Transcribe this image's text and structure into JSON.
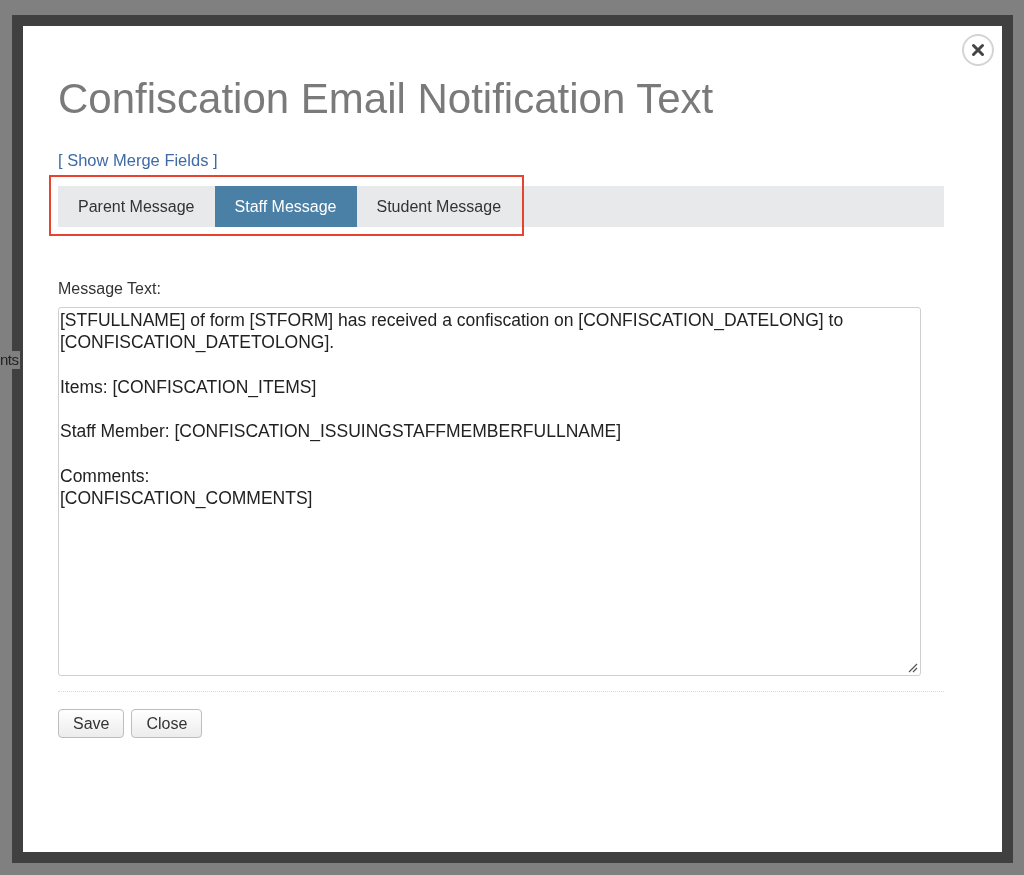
{
  "background": {
    "text": "nts"
  },
  "dialog": {
    "title": "Confiscation Email Notification Text",
    "merge_fields_link": "[ Show Merge Fields ]",
    "tabs": [
      {
        "label": "Parent Message",
        "selected": false
      },
      {
        "label": "Staff Message",
        "selected": true
      },
      {
        "label": "Student Message",
        "selected": false
      }
    ],
    "message_text": {
      "label": "Message Text:",
      "value": "[STFULLNAME] of form [STFORM] has received a confiscation on [CONFISCATION_DATELONG] to [CONFISCATION_DATETOLONG].\n\nItems: [CONFISCATION_ITEMS]\n\nStaff Member: [CONFISCATION_ISSUINGSTAFFMEMBERFULLNAME]\n\nComments:\n[CONFISCATION_COMMENTS]"
    },
    "buttons": [
      "Save",
      "Close"
    ]
  }
}
